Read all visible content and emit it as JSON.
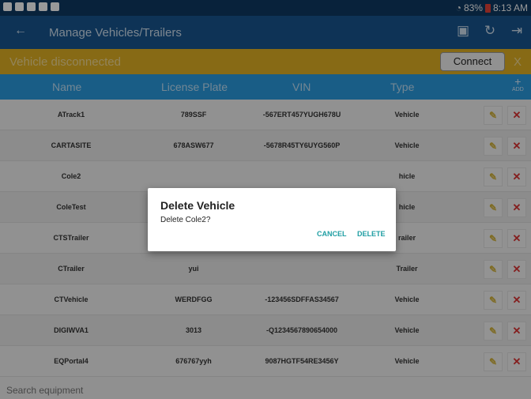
{
  "status_bar": {
    "battery_text": "83%",
    "time": "8:13 AM"
  },
  "app_bar": {
    "title": "Manage Vehicles/Trailers",
    "back_icon": "arrow-left-icon",
    "actions": [
      "device-icon",
      "refresh-icon",
      "logout-icon"
    ]
  },
  "banner": {
    "message": "Vehicle disconnected",
    "connect_label": "Connect",
    "close_label": "X"
  },
  "columns": {
    "name": "Name",
    "plate": "License Plate",
    "vin": "VIN",
    "type": "Type",
    "add": "ADD"
  },
  "rows": [
    {
      "name": "ATrack1",
      "plate": "789SSF",
      "vin": "-567ERT457YUGH678U",
      "type": "Vehicle"
    },
    {
      "name": "CARTASITE",
      "plate": "678ASW677",
      "vin": "-5678R45TY6UYG560P",
      "type": "Vehicle"
    },
    {
      "name": "Cole2",
      "plate": "",
      "vin": "",
      "type": "hicle"
    },
    {
      "name": "ColeTest",
      "plate": "",
      "vin": "",
      "type": "hicle"
    },
    {
      "name": "CTSTrailer",
      "plate": "",
      "vin": "",
      "type": "railer"
    },
    {
      "name": "CTrailer",
      "plate": "yui",
      "vin": "",
      "type": "Trailer"
    },
    {
      "name": "CTVehicle",
      "plate": "WERDFGG",
      "vin": "-123456SDFFAS34567",
      "type": "Vehicle"
    },
    {
      "name": "DIGIWVA1",
      "plate": "3013",
      "vin": "-Q1234567890654000",
      "type": "Vehicle"
    },
    {
      "name": "EQPortal4",
      "plate": "676767yyh",
      "vin": "9087HGTF54RE3456Y",
      "type": "Vehicle"
    }
  ],
  "search": {
    "placeholder": "Search equipment"
  },
  "dialog": {
    "title": "Delete Vehicle",
    "message": "Delete Cole2?",
    "cancel_label": "CANCEL",
    "delete_label": "DELETE"
  },
  "colors": {
    "status_bar": "#0e3a63",
    "app_bar": "#185590",
    "banner": "#e2b123",
    "column_header": "#2a9be0",
    "dialog_button": "#1f9ea3",
    "delete_icon": "#dd3333"
  }
}
